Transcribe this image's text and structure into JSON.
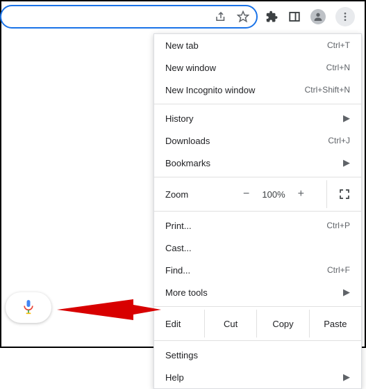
{
  "menu": {
    "newTab": {
      "label": "New tab",
      "shortcut": "Ctrl+T"
    },
    "newWindow": {
      "label": "New window",
      "shortcut": "Ctrl+N"
    },
    "newIncognito": {
      "label": "New Incognito window",
      "shortcut": "Ctrl+Shift+N"
    },
    "history": {
      "label": "History"
    },
    "downloads": {
      "label": "Downloads",
      "shortcut": "Ctrl+J"
    },
    "bookmarks": {
      "label": "Bookmarks"
    },
    "zoom": {
      "label": "Zoom",
      "value": "100%"
    },
    "print": {
      "label": "Print...",
      "shortcut": "Ctrl+P"
    },
    "cast": {
      "label": "Cast..."
    },
    "find": {
      "label": "Find...",
      "shortcut": "Ctrl+F"
    },
    "moreTools": {
      "label": "More tools"
    },
    "edit": {
      "label": "Edit",
      "cut": "Cut",
      "copy": "Copy",
      "paste": "Paste"
    },
    "settings": {
      "label": "Settings"
    },
    "help": {
      "label": "Help"
    }
  }
}
